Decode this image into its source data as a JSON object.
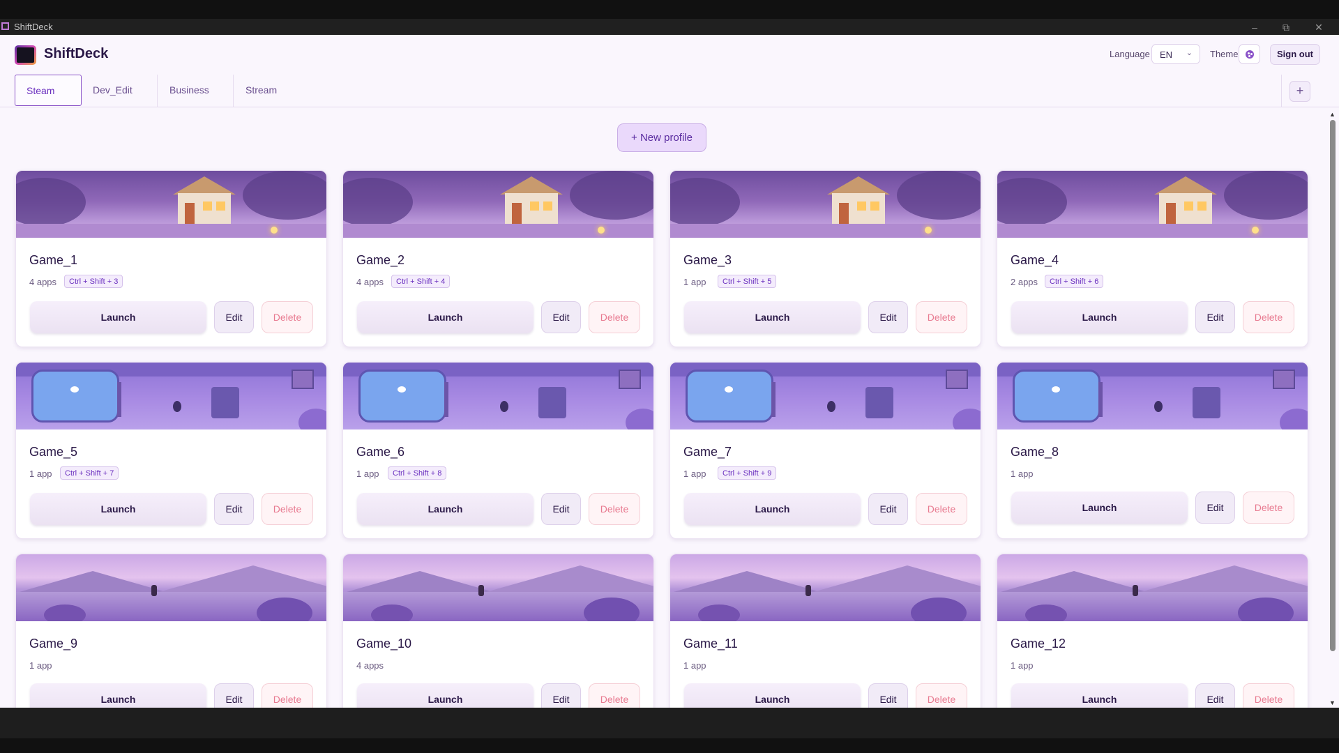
{
  "window": {
    "title": "ShiftDeck"
  },
  "header": {
    "brand": "ShiftDeck",
    "language_label": "Language",
    "language_value": "EN",
    "theme_label": "Theme",
    "signout_label": "Sign out"
  },
  "tabs": [
    {
      "label": "Steam",
      "active": true
    },
    {
      "label": "Dev_Edit",
      "active": false
    },
    {
      "label": "Business",
      "active": false
    },
    {
      "label": "Stream",
      "active": false
    }
  ],
  "add_tab_label": "+",
  "new_profile_label": "+ New profile",
  "buttons": {
    "launch": "Launch",
    "edit": "Edit",
    "delete": "Delete"
  },
  "profiles": [
    {
      "name": "Game_1",
      "apps": "4 apps",
      "shortcut": "Ctrl + Shift + 3",
      "banner": "cottage"
    },
    {
      "name": "Game_2",
      "apps": "4 apps",
      "shortcut": "Ctrl + Shift + 4",
      "banner": "cottage"
    },
    {
      "name": "Game_3",
      "apps": "1 app",
      "shortcut": "Ctrl + Shift + 5",
      "banner": "cottage"
    },
    {
      "name": "Game_4",
      "apps": "2 apps",
      "shortcut": "Ctrl + Shift + 6",
      "banner": "cottage"
    },
    {
      "name": "Game_5",
      "apps": "1 app",
      "shortcut": "Ctrl + Shift + 7",
      "banner": "village"
    },
    {
      "name": "Game_6",
      "apps": "1 app",
      "shortcut": "Ctrl + Shift + 8",
      "banner": "village"
    },
    {
      "name": "Game_7",
      "apps": "1 app",
      "shortcut": "Ctrl + Shift + 9",
      "banner": "village"
    },
    {
      "name": "Game_8",
      "apps": "1 app",
      "shortcut": "",
      "banner": "village"
    },
    {
      "name": "Game_9",
      "apps": "1 app",
      "shortcut": "",
      "banner": "meadow"
    },
    {
      "name": "Game_10",
      "apps": "4 apps",
      "shortcut": "",
      "banner": "meadow"
    },
    {
      "name": "Game_11",
      "apps": "1 app",
      "shortcut": "",
      "banner": "meadow"
    },
    {
      "name": "Game_12",
      "apps": "1 app",
      "shortcut": "",
      "banner": "meadow"
    }
  ],
  "icons": {
    "logo": "shiftdeck-logo",
    "theme": "palette-icon",
    "language_chevron": "chevron-down-icon",
    "minimize": "minimize-icon",
    "restore": "restore-icon",
    "close": "close-icon"
  },
  "colors": {
    "accent": "#6a2fbf",
    "background": "#faf6fd",
    "delete_text": "#e87a90"
  }
}
